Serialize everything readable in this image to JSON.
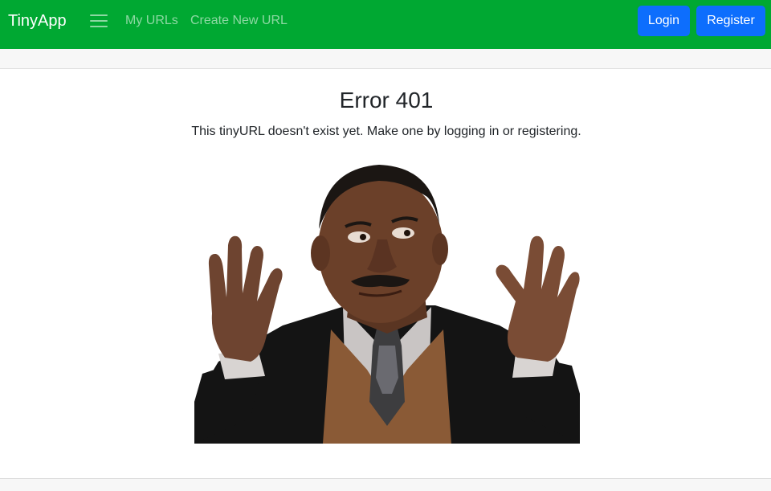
{
  "navbar": {
    "brand": "TinyApp",
    "toggler_icon": "hamburger-menu-icon",
    "links": [
      "My URLs",
      "Create New URL"
    ],
    "login_label": "Login",
    "register_label": "Register",
    "background_color": "#00a832",
    "button_color": "#0d6efd"
  },
  "main": {
    "title": "Error 401",
    "message": "This tinyURL doesn't exist yet. Make one by logging in or registering.",
    "image_subject": "shrugging-man-photo"
  }
}
